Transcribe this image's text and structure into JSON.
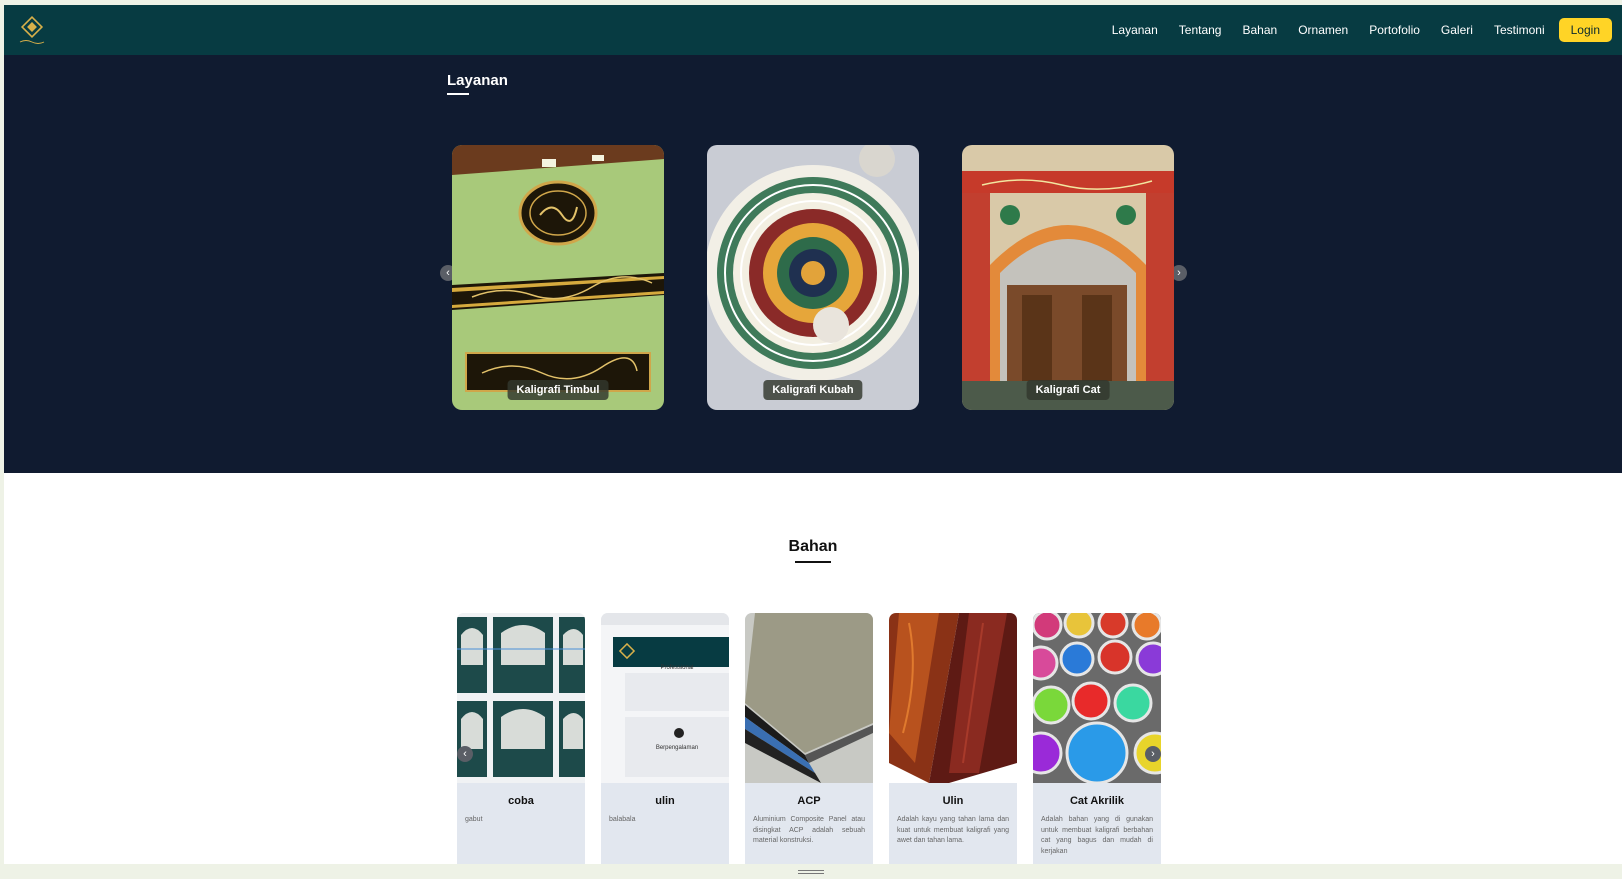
{
  "nav": {
    "links": [
      "Layanan",
      "Tentang",
      "Bahan",
      "Ornamen",
      "Portofolio",
      "Galeri",
      "Testimoni"
    ],
    "login": "Login"
  },
  "layanan": {
    "title": "Layanan",
    "cards": [
      {
        "label": "Kaligrafi Timbul"
      },
      {
        "label": "Kaligrafi Kubah"
      },
      {
        "label": "Kaligrafi Cat"
      }
    ]
  },
  "bahan": {
    "title": "Bahan",
    "cards": [
      {
        "title": "coba",
        "desc": "gabut"
      },
      {
        "title": "ulin",
        "desc": "balabala",
        "screenshot_texts": [
          "Professional",
          "Berpengalaman"
        ]
      },
      {
        "title": "ACP",
        "desc": "Aluminium Composite Panel atau disingkat ACP adalah sebuah material konstruksi."
      },
      {
        "title": "Ulin",
        "desc": "Adalah kayu yang tahan lama dan kuat untuk membuat kaligrafi yang awet dan tahan lama."
      },
      {
        "title": "Cat Akrilik",
        "desc": "Adalah bahan yang di gunakan untuk membuat kaligrafi berbahan cat yang bagus dan mudah di kerjakan"
      }
    ]
  },
  "colors": {
    "navbar": "#073b42",
    "layanan_bg": "#101b30",
    "login_btn": "#ffd426",
    "card_bg": "#e2e7ef"
  }
}
